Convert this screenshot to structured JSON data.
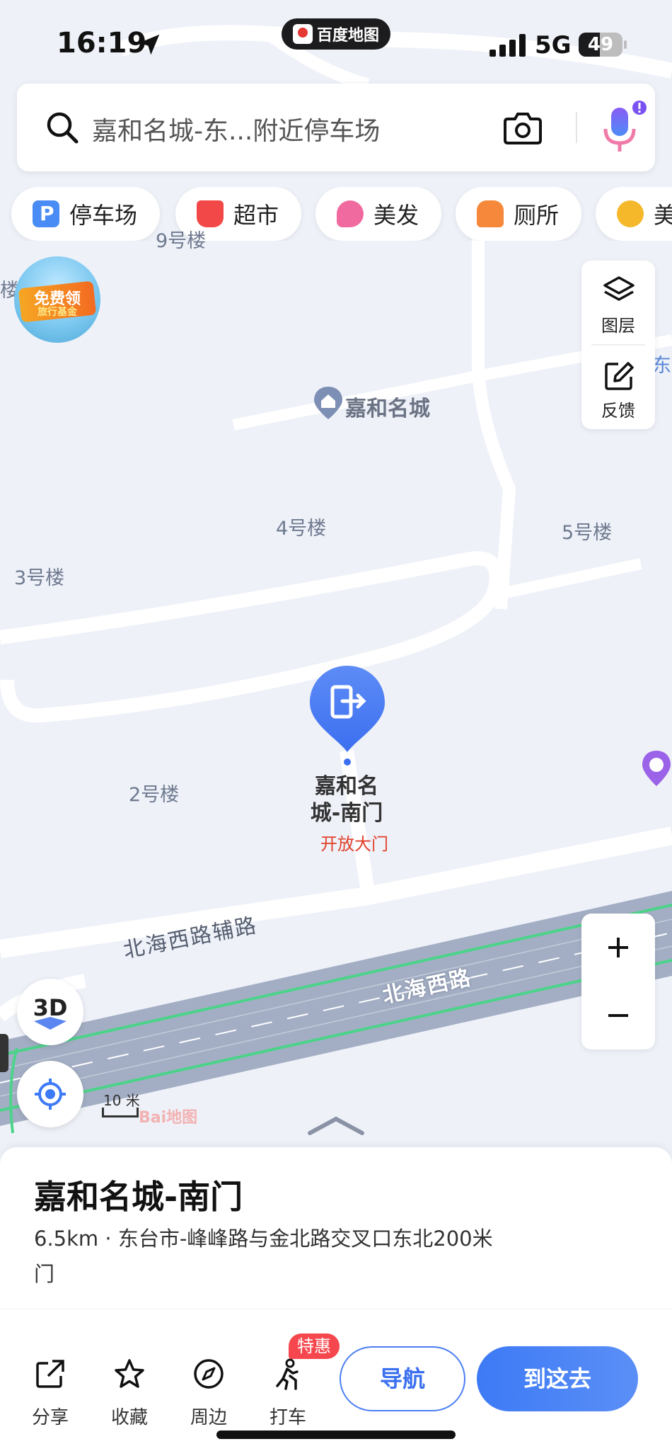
{
  "status_bar": {
    "time": "16:19",
    "app_pill": "百度地图",
    "network": "5G",
    "battery": "49",
    "battery_percent": 49
  },
  "search": {
    "text": "嘉和名城-东...附近停车场"
  },
  "chips": [
    {
      "label": "停车场",
      "icon": "parking-icon",
      "color": "#4a8cf5"
    },
    {
      "label": "超市",
      "icon": "cart-icon",
      "color": "#f24848"
    },
    {
      "label": "美发",
      "icon": "hair-icon",
      "color": "#f06aa0"
    },
    {
      "label": "厕所",
      "icon": "toilet-icon",
      "color": "#f5883a"
    },
    {
      "label": "美",
      "icon": "food-icon",
      "color": "#f5b82a"
    }
  ],
  "promo": {
    "line1": "免费领",
    "line2": "旅行基金"
  },
  "side_tools": {
    "layers": "图层",
    "feedback": "反馈"
  },
  "map_labels": {
    "building_9": "9号楼",
    "building_4": "4号楼",
    "building_5": "5号楼",
    "building_3": "3号楼",
    "building_2": "2号楼",
    "edge_left": "楼",
    "edge_right": "东",
    "poi_community": "嘉和名城",
    "road_aux": "北海西路辅路",
    "road_main": "北海西路",
    "scale": "10 米",
    "watermark": "Bai地图"
  },
  "pin": {
    "title_line1": "嘉和名",
    "title_line2": "城-南门",
    "subtitle": "开放大门"
  },
  "map_controls": {
    "three_d": "3D"
  },
  "place": {
    "name": "嘉和名城-南门",
    "address_line1": "6.5km · 东台市-峰峰路与金北路交叉口东北200米",
    "address_line2": "门"
  },
  "actions": [
    {
      "label": "分享",
      "icon": "share-icon"
    },
    {
      "label": "收藏",
      "icon": "star-icon"
    },
    {
      "label": "周边",
      "icon": "compass-icon"
    },
    {
      "label": "打车",
      "icon": "taxi-icon"
    }
  ],
  "taxi_badge": "特惠",
  "navigate_label": "导航",
  "go_label": "到这去",
  "colors": {
    "accent": "#3d7af5",
    "map_bg": "#eef1f8",
    "road": "#a3aec4",
    "road_edge": "#4cd38a"
  }
}
